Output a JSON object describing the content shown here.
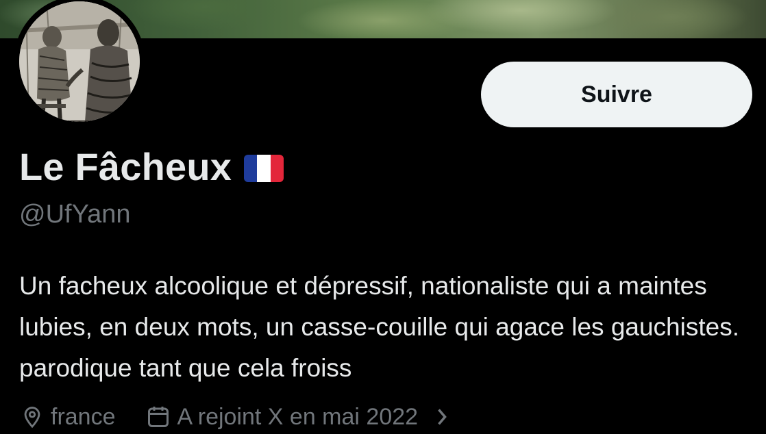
{
  "profile": {
    "display_name": "Le Fâcheux",
    "handle": "@UfYann",
    "bio": "Un facheux alcoolique et dépressif, nationaliste qui a maintes lubies, en deux mots, un casse-couille qui agace les gauchistes. parodique tant que cela froiss",
    "location": "france",
    "joined": "A rejoint X en mai 2022"
  },
  "actions": {
    "follow_label": "Suivre"
  },
  "icons": {
    "location": "location-pin-icon",
    "calendar": "calendar-icon",
    "chevron": "chevron-right-icon",
    "flag": "france-flag-icon"
  },
  "colors": {
    "background": "#000000",
    "primary_text": "#e7e9ea",
    "secondary_text": "#71767b",
    "button_bg": "#eff3f4",
    "button_text": "#0f1419",
    "flag_blue": "#1f3c9c",
    "flag_white": "#ffffff",
    "flag_red": "#e3263a"
  }
}
